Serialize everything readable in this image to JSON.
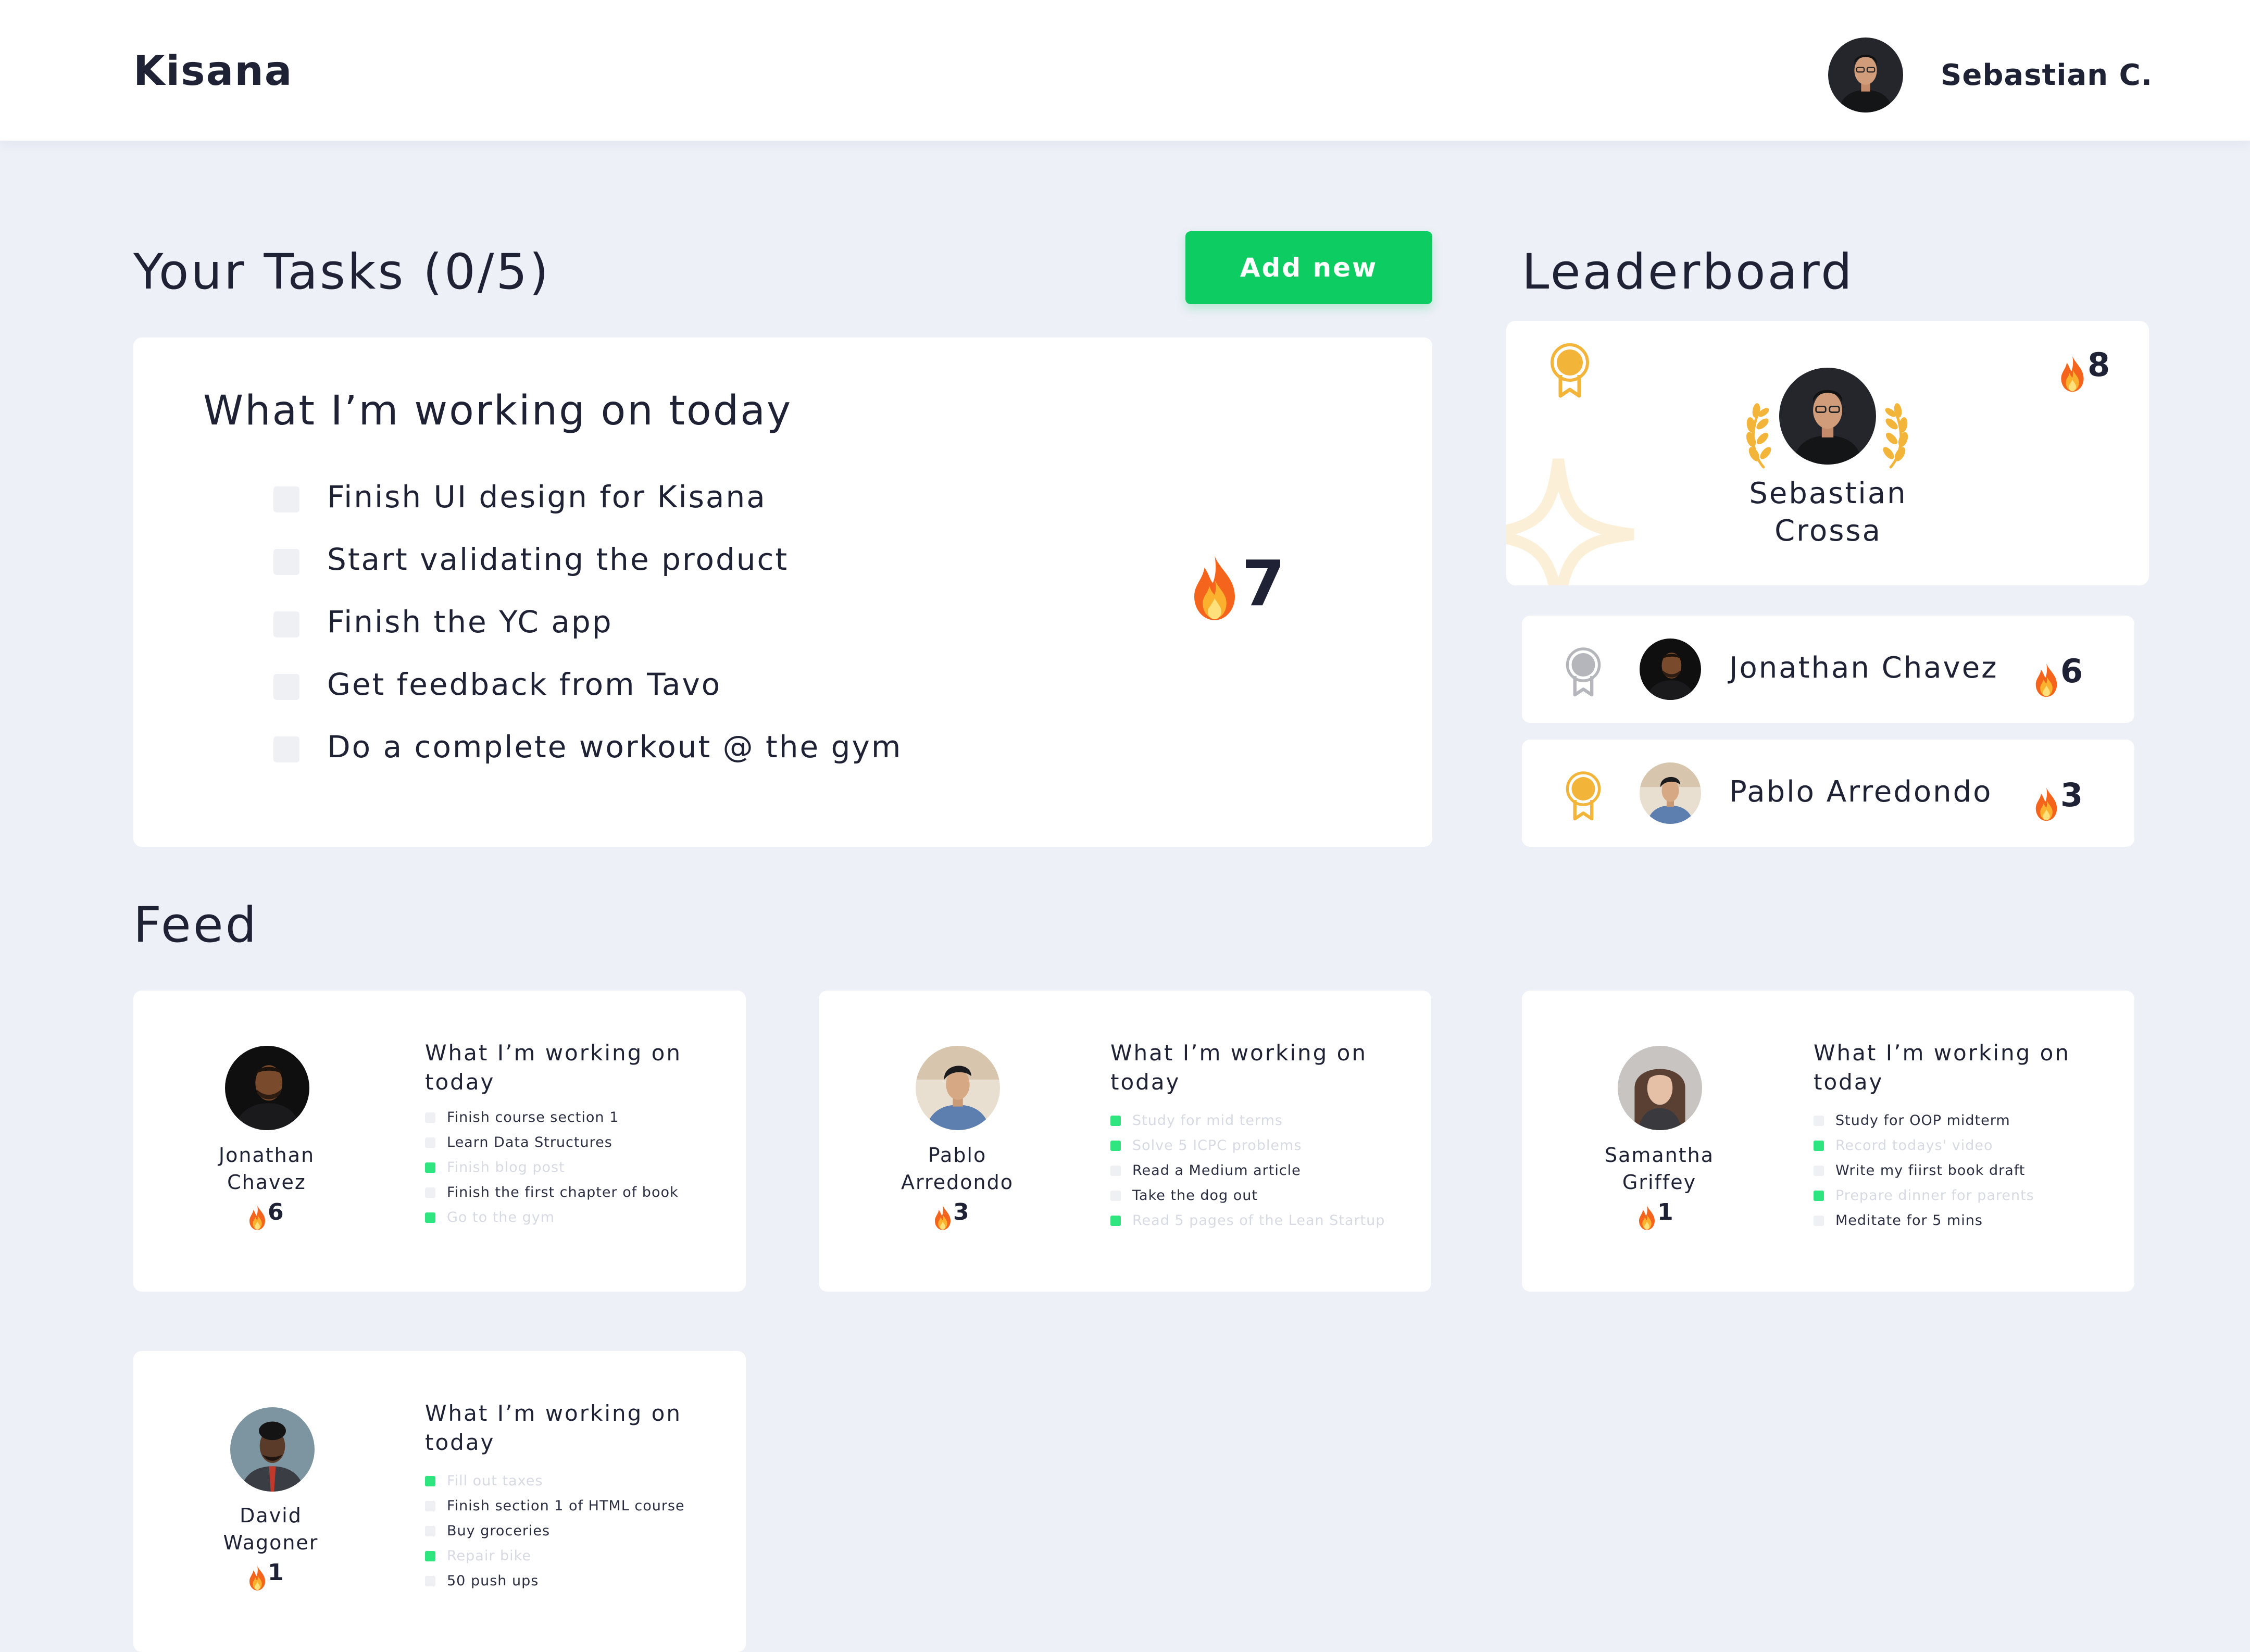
{
  "app": {
    "brand": "Kisana"
  },
  "user": {
    "name": "Sebastian C."
  },
  "tasks": {
    "title": "Your Tasks (0/5)",
    "add_label": "Add new",
    "heading": "What I’m working on today",
    "streak": "7",
    "items": [
      {
        "label": "Finish UI design for Kisana",
        "done": false
      },
      {
        "label": "Start validating the product",
        "done": false
      },
      {
        "label": "Finish the YC app",
        "done": false
      },
      {
        "label": "Get feedback from Tavo",
        "done": false
      },
      {
        "label": "Do a complete workout @ the gym",
        "done": false
      }
    ]
  },
  "leaderboard": {
    "title": "Leaderboard",
    "first": {
      "name_line1": "Sebastian",
      "name_line2": "Crossa",
      "score": "8",
      "medal": "gold"
    },
    "others": [
      {
        "name": "Jonathan Chavez",
        "score": "6",
        "medal": "silver"
      },
      {
        "name": "Pablo Arredondo",
        "score": "3",
        "medal": "bronze"
      }
    ]
  },
  "feed": {
    "title": "Feed",
    "cards": [
      {
        "name_line1": "Jonathan",
        "name_line2": "Chavez",
        "score": "6",
        "heading_line1": "What I’m working on",
        "heading_line2": "today",
        "items": [
          {
            "label": "Finish course section 1",
            "done": false
          },
          {
            "label": "Learn Data Structures",
            "done": false
          },
          {
            "label": "Finish blog post",
            "done": true
          },
          {
            "label": "Finish the first chapter of book",
            "done": false
          },
          {
            "label": "Go to the gym",
            "done": true
          }
        ]
      },
      {
        "name_line1": "Pablo",
        "name_line2": "Arredondo",
        "score": "3",
        "heading_line1": "What I’m working on",
        "heading_line2": "today",
        "items": [
          {
            "label": "Study for mid terms",
            "done": true
          },
          {
            "label": "Solve 5 ICPC problems",
            "done": true
          },
          {
            "label": "Read a Medium article",
            "done": false
          },
          {
            "label": "Take the dog out",
            "done": false
          },
          {
            "label": "Read 5 pages of the Lean Startup",
            "done": true
          }
        ]
      },
      {
        "name_line1": "Samantha",
        "name_line2": "Griffey",
        "score": "1",
        "heading_line1": "What I’m working on",
        "heading_line2": "today",
        "items": [
          {
            "label": "Study for OOP midterm",
            "done": false
          },
          {
            "label": "Record todays' video",
            "done": true
          },
          {
            "label": "Write my fiirst book draft",
            "done": false
          },
          {
            "label": "Prepare dinner for parents",
            "done": true
          },
          {
            "label": "Meditate for 5 mins",
            "done": false
          }
        ]
      },
      {
        "name_line1": "David",
        "name_line2": "Wagoner",
        "score": "1",
        "heading_line1": "What I’m working on",
        "heading_line2": "today",
        "items": [
          {
            "label": "Fill out taxes",
            "done": true
          },
          {
            "label": "Finish section 1 of HTML course",
            "done": false
          },
          {
            "label": "Buy groceries",
            "done": false
          },
          {
            "label": "Repair bike",
            "done": true
          },
          {
            "label": "50 push ups",
            "done": false
          }
        ]
      }
    ]
  },
  "colors": {
    "accent": "#0ccc62",
    "done_marker": "#2ee57f",
    "background": "#edf0f7",
    "gold": "#f2b53a",
    "silver": "#b4b6bb"
  }
}
